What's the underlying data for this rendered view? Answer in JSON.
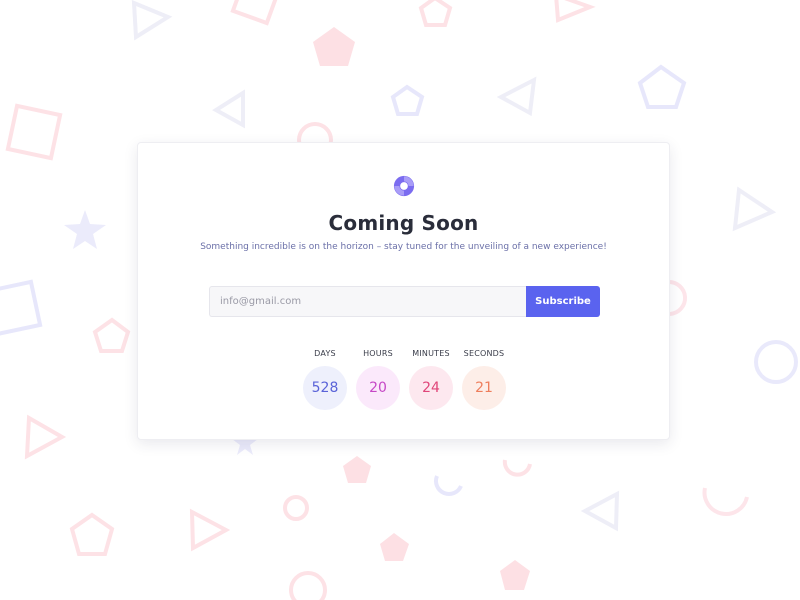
{
  "brand": {
    "logo_icon": "swirl-logo-icon",
    "accent_color": "#5a63ef"
  },
  "hero": {
    "title": "Coming Soon",
    "subtitle": "Something incredible is on the horizon – stay tuned for the unveiling of a new experience!"
  },
  "subscribe": {
    "email_placeholder": "info@gmail.com",
    "button_label": "Subscribe"
  },
  "countdown": {
    "units": [
      {
        "label": "DAYS",
        "value": "528",
        "text_color": "#5a63d8",
        "bg_color": "#eef0fc"
      },
      {
        "label": "HOURS",
        "value": "20",
        "text_color": "#c648c6",
        "bg_color": "#fbe9fb"
      },
      {
        "label": "MINUTES",
        "value": "24",
        "text_color": "#e0467a",
        "bg_color": "#fde8ef"
      },
      {
        "label": "SECONDS",
        "value": "21",
        "text_color": "#ee7e5c",
        "bg_color": "#fdeee8"
      }
    ]
  }
}
